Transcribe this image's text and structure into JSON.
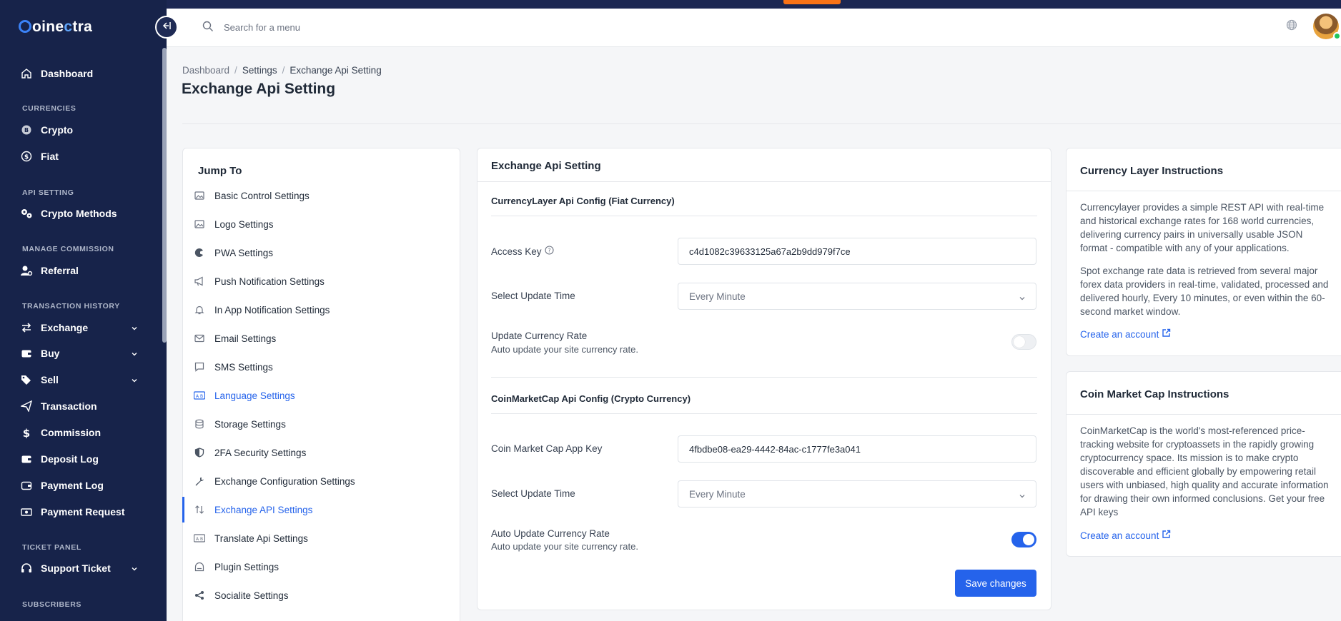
{
  "app": {
    "logo_prefix": "oine",
    "logo_accent": "c",
    "logo_suffix": "tra"
  },
  "sidebar": {
    "items": {
      "dashboard": "Dashboard",
      "crypto": "Crypto",
      "fiat": "Fiat",
      "crypto_methods": "Crypto Methods",
      "referral": "Referral",
      "exchange": "Exchange",
      "buy": "Buy",
      "sell": "Sell",
      "transaction": "Transaction",
      "commission": "Commission",
      "deposit_log": "Deposit Log",
      "payment_log": "Payment Log",
      "payment_request": "Payment Request",
      "support_ticket": "Support Ticket"
    },
    "sections": {
      "currencies": "CURRENCIES",
      "api_setting": "API SETTING",
      "manage_commission": "MANAGE COMMISSION",
      "transaction_history": "TRANSACTION HISTORY",
      "ticket_panel": "TICKET PANEL",
      "subscribers": "SUBSCRIBERS"
    }
  },
  "header": {
    "search_placeholder": "Search for a menu"
  },
  "breadcrumb": {
    "home": "Dashboard",
    "settings": "Settings",
    "current": "Exchange Api Setting"
  },
  "page_title": "Exchange Api Setting",
  "jump": {
    "title": "Jump To",
    "items": [
      "Basic Control Settings",
      "Logo Settings",
      "PWA Settings",
      "Push Notification Settings",
      "In App Notification Settings",
      "Email Settings",
      "SMS Settings",
      "Language Settings",
      "Storage Settings",
      "2FA Security Settings",
      "Exchange Configuration Settings",
      "Exchange API Settings",
      "Translate Api Settings",
      "Plugin Settings",
      "Socialite Settings"
    ]
  },
  "main": {
    "title": "Exchange Api Setting",
    "currencylayer": {
      "title": "CurrencyLayer Api Config (Fiat Currency)",
      "access_key_label": "Access Key",
      "access_key_value": "c4d1082c39633125a67a2b9dd979f7ce",
      "update_time_label": "Select Update Time",
      "update_time_value": "Every Minute",
      "toggle_title": "Update Currency Rate",
      "toggle_sub": "Auto update your site currency rate.",
      "toggle_on": false
    },
    "coinmarketcap": {
      "title": "CoinMarketCap Api Config (Crypto Currency)",
      "app_key_label": "Coin Market Cap App Key",
      "app_key_value": "4fbdbe08-ea29-4442-84ac-c1777fe3a041",
      "update_time_label": "Select Update Time",
      "update_time_value": "Every Minute",
      "toggle_title": "Auto Update Currency Rate",
      "toggle_sub": "Auto update your site currency rate.",
      "toggle_on": true
    },
    "save_label": "Save changes"
  },
  "info_currencylayer": {
    "title": "Currency Layer Instructions",
    "para1": "Currencylayer provides a simple REST API with real-time and historical exchange rates for 168 world currencies, delivering currency pairs in universally usable JSON format - compatible with any of your applications.",
    "para2": "Spot exchange rate data is retrieved from several major forex data providers in real-time, validated, processed and delivered hourly, Every 10 minutes, or even within the 60-second market window.",
    "link": "Create an account"
  },
  "info_coinmarketcap": {
    "title": "Coin Market Cap Instructions",
    "para1": "CoinMarketCap is the world's most-referenced price-tracking website for cryptoassets in the rapidly growing cryptocurrency space. Its mission is to make crypto discoverable and efficient globally by empowering retail users with unbiased, high quality and accurate information for drawing their own informed conclusions. Get your free API keys",
    "link": "Create an account"
  },
  "colors": {
    "accent": "#2563eb",
    "sidebar_bg": "#17234a",
    "top_strip": "#1c2752",
    "highlight": "#f97316"
  }
}
